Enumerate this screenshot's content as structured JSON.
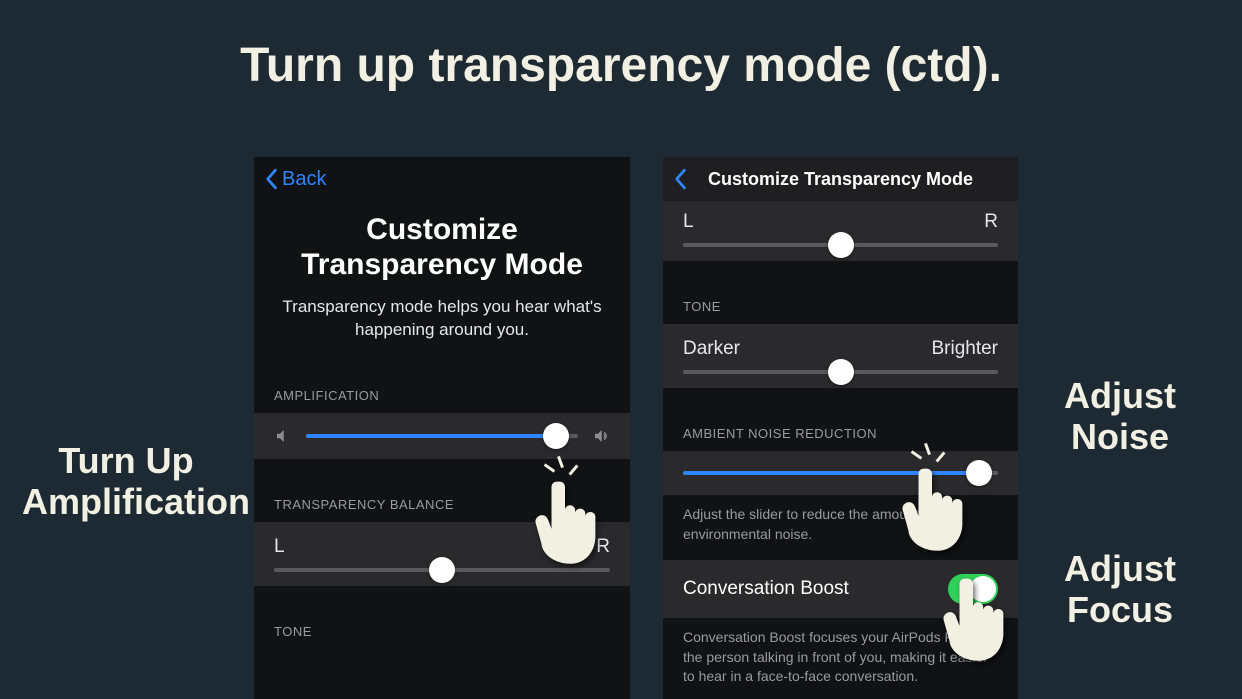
{
  "slide": {
    "title": "Turn up transparency mode (ctd)."
  },
  "annotations": {
    "amplification": "Turn Up Amplification",
    "noise": "Adjust Noise",
    "focus": "Adjust Focus"
  },
  "left": {
    "back_label": "Back",
    "title": "Customize Transparency Mode",
    "subtitle": "Transparency mode helps you hear what's happening around you.",
    "amplification_header": "AMPLIFICATION",
    "balance_header": "TRANSPARENCY BALANCE",
    "balance_left": "L",
    "balance_right": "R",
    "tone_header": "TONE"
  },
  "right": {
    "title": "Customize Transparency Mode",
    "lr_left": "L",
    "lr_right": "R",
    "tone_header": "TONE",
    "tone_left": "Darker",
    "tone_right": "Brighter",
    "noise_header": "AMBIENT NOISE REDUCTION",
    "noise_desc": "Adjust the slider to reduce the amount of environmental noise.",
    "boost_label": "Conversation Boost",
    "boost_desc": "Conversation Boost focuses your AirPods Pro on the person talking in front of you, making it easier to hear in a face-to-face conversation."
  }
}
